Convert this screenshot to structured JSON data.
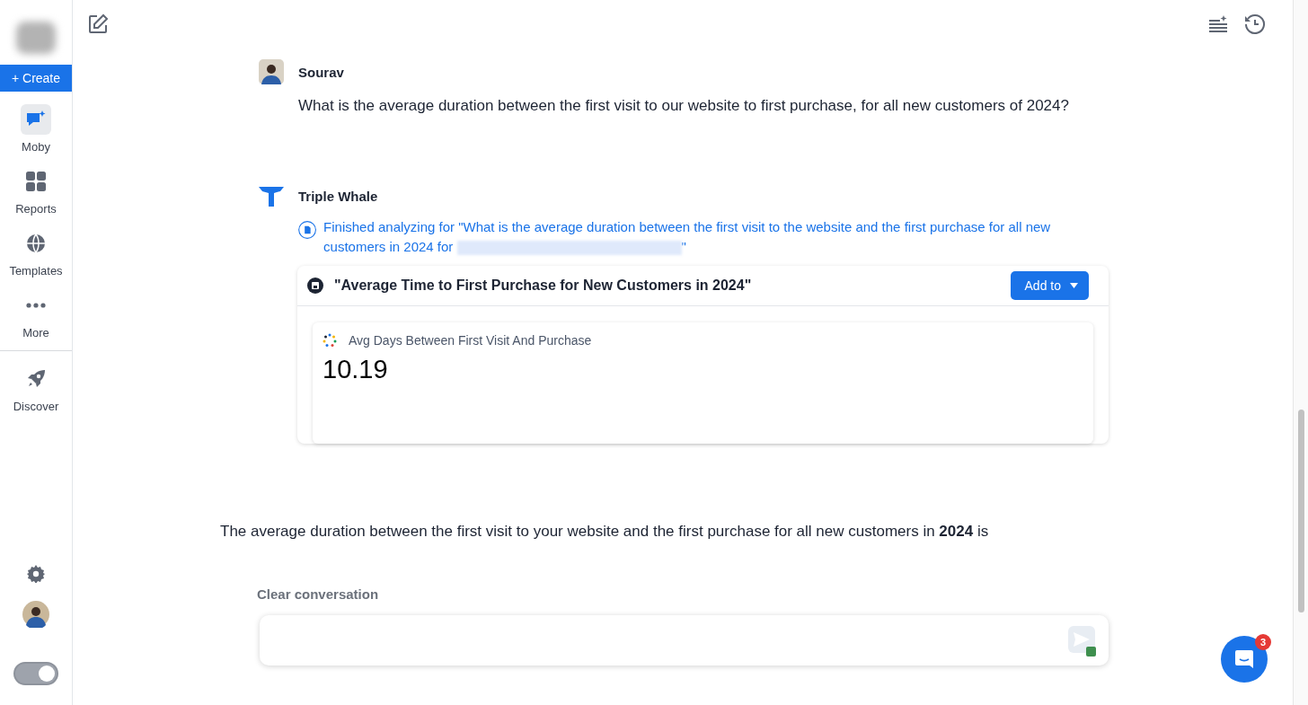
{
  "sidebar": {
    "create_button": "+ Create",
    "items": [
      {
        "label": "Moby",
        "selected": true
      },
      {
        "label": "Reports",
        "selected": false
      },
      {
        "label": "Templates",
        "selected": false
      },
      {
        "label": "More",
        "selected": false
      },
      {
        "label": "Discover",
        "selected": false
      }
    ],
    "dark_mode_toggle": {
      "on": true
    }
  },
  "messages": [
    {
      "kind": "user",
      "author": "Sourav",
      "text": "What is the average duration between the first visit to our website to first purchase, for all new customers of 2024?"
    },
    {
      "kind": "assistant",
      "author": "Triple Whale",
      "status_text": "Finished analyzing for \"What is the average duration between the first visit to the website and the first purchase for all new customers in 2024 for",
      "status_end": "\"",
      "report": {
        "title": "\"Average Time to First Purchase for New Customers in 2024\"",
        "button": "Add to",
        "metric_label": "Avg Days Between First Visit And Purchase",
        "metric_value": "10.19"
      }
    }
  ],
  "answer_text": "The average duration between the first visit to your website and the first purchase for all new customers in **2024** is",
  "clear_button": "Clear conversation",
  "chat_badge": "3"
}
